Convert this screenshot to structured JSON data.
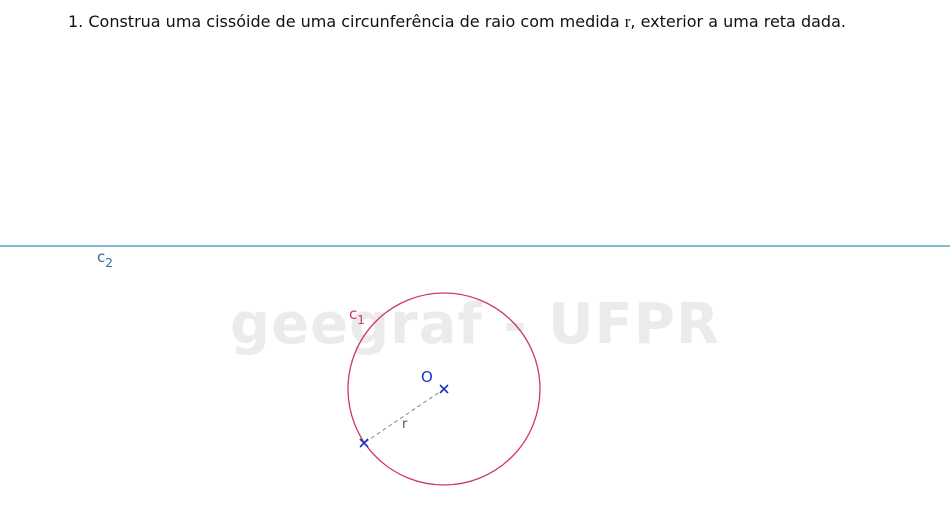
{
  "exercise": {
    "number": "1.",
    "text_before": "Construa uma cissóide de uma circunferência de raio com medida ",
    "variable": "r",
    "text_after": ", exterior a uma reta dada."
  },
  "watermark": "geegraf - UFPR",
  "figure": {
    "line_label_main": "c",
    "line_label_sub": "2",
    "circle_label_main": "c",
    "circle_label_sub": "1",
    "center_label": "O",
    "radius_label": "r",
    "colors": {
      "line": "#3a8fb7",
      "line_label": "#2b6a9a",
      "circle": "#d0395a",
      "points": "#1a33cc",
      "radius": "#888888"
    }
  }
}
